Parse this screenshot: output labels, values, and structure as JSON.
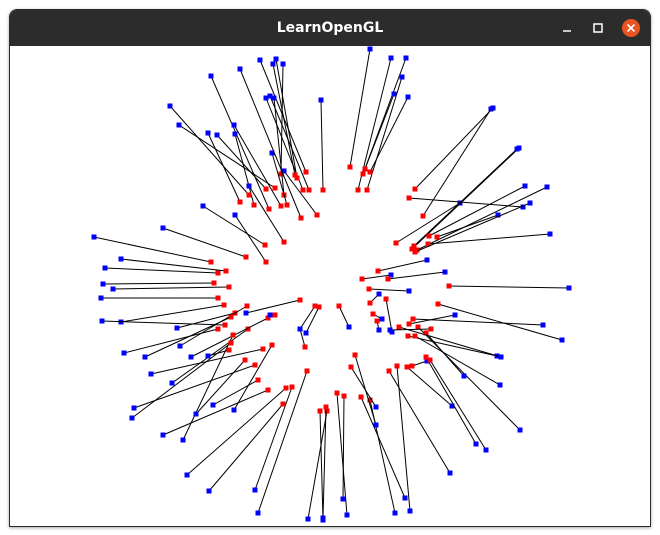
{
  "window": {
    "title": "LearnOpenGL",
    "controls": {
      "minimize_icon": "minimize-icon",
      "maximize_icon": "maximize-icon",
      "close_icon": "close-icon"
    },
    "colors": {
      "titlebar": "#2c2c2c",
      "title_text": "#ffffff",
      "close_button": "#e95420"
    }
  },
  "scene": {
    "background": "#ffffff",
    "line_color": "#000000",
    "start_point_color": "#ff0000",
    "end_point_color": "#0000ff",
    "segments": [
      [
        350,
        167,
        370,
        49
      ],
      [
        358,
        190,
        391,
        58
      ],
      [
        363,
        174,
        406,
        58
      ],
      [
        367,
        190,
        402,
        77
      ],
      [
        370,
        172,
        408,
        97
      ],
      [
        365,
        169,
        394,
        94
      ],
      [
        323,
        190,
        321,
        100
      ],
      [
        309,
        190,
        270,
        96
      ],
      [
        303,
        190,
        266,
        98
      ],
      [
        297,
        178,
        276,
        59
      ],
      [
        295,
        175,
        273,
        64
      ],
      [
        281,
        174,
        283,
        64
      ],
      [
        306,
        172,
        260,
        60
      ],
      [
        284,
        195,
        274,
        98
      ],
      [
        287,
        205,
        272,
        153
      ],
      [
        317,
        215,
        284,
        171
      ],
      [
        301,
        218,
        240,
        69
      ],
      [
        269,
        209,
        211,
        76
      ],
      [
        281,
        206,
        234,
        125
      ],
      [
        254,
        205,
        235,
        134
      ],
      [
        275,
        188,
        179,
        125
      ],
      [
        249,
        195,
        170,
        106
      ],
      [
        266,
        189,
        217,
        135
      ],
      [
        240,
        202,
        208,
        133
      ],
      [
        284,
        242,
        249,
        186
      ],
      [
        265,
        245,
        203,
        206
      ],
      [
        246,
        257,
        163,
        228
      ],
      [
        266,
        262,
        235,
        215
      ],
      [
        211,
        262,
        94,
        237
      ],
      [
        218,
        273,
        105,
        268
      ],
      [
        226,
        271,
        121,
        259
      ],
      [
        229,
        287,
        113,
        289
      ],
      [
        214,
        283,
        103,
        284
      ],
      [
        218,
        298,
        101,
        298
      ],
      [
        224,
        305,
        121,
        322
      ],
      [
        225,
        325,
        102,
        321
      ],
      [
        235,
        313,
        177,
        328
      ],
      [
        247,
        306,
        180,
        346
      ],
      [
        231,
        317,
        145,
        357
      ],
      [
        218,
        329,
        124,
        353
      ],
      [
        248,
        329,
        172,
        383
      ],
      [
        268,
        318,
        191,
        357
      ],
      [
        263,
        349,
        151,
        374
      ],
      [
        255,
        365,
        134,
        408
      ],
      [
        233,
        335,
        183,
        440
      ],
      [
        231,
        343,
        132,
        418
      ],
      [
        258,
        380,
        213,
        405
      ],
      [
        272,
        345,
        234,
        410
      ],
      [
        245,
        360,
        196,
        414
      ],
      [
        268,
        390,
        163,
        435
      ],
      [
        286,
        388,
        187,
        475
      ],
      [
        292,
        387,
        255,
        490
      ],
      [
        283,
        404,
        209,
        491
      ],
      [
        307,
        371,
        258,
        513
      ],
      [
        327,
        411,
        308,
        519
      ],
      [
        320,
        411,
        323,
        520
      ],
      [
        326,
        407,
        323,
        518
      ],
      [
        337,
        393,
        347,
        515
      ],
      [
        344,
        396,
        343,
        499
      ],
      [
        361,
        397,
        405,
        498
      ],
      [
        370,
        400,
        395,
        513
      ],
      [
        355,
        355,
        376,
        425
      ],
      [
        389,
        371,
        450,
        473
      ],
      [
        397,
        366,
        410,
        511
      ],
      [
        351,
        367,
        376,
        407
      ],
      [
        407,
        367,
        452,
        406
      ],
      [
        412,
        366,
        427,
        361
      ],
      [
        408,
        336,
        497,
        356
      ],
      [
        426,
        357,
        476,
        444
      ],
      [
        430,
        360,
        486,
        450
      ],
      [
        409,
        324,
        455,
        315
      ],
      [
        418,
        327,
        520,
        430
      ],
      [
        426,
        333,
        464,
        376
      ],
      [
        413,
        319,
        543,
        325
      ],
      [
        438,
        304,
        562,
        340
      ],
      [
        415,
        336,
        500,
        385
      ],
      [
        399,
        327,
        501,
        357
      ],
      [
        377,
        321,
        379,
        330
      ],
      [
        373,
        314,
        382,
        319
      ],
      [
        370,
        303,
        379,
        294
      ],
      [
        386,
        299,
        392,
        332
      ],
      [
        431,
        329,
        390,
        330
      ],
      [
        449,
        286,
        569,
        288
      ],
      [
        369,
        289,
        409,
        291
      ],
      [
        362,
        279,
        391,
        275
      ],
      [
        378,
        271,
        427,
        260
      ],
      [
        388,
        279,
        445,
        272
      ],
      [
        396,
        243,
        460,
        203
      ],
      [
        412,
        249,
        519,
        148
      ],
      [
        414,
        246,
        517,
        149
      ],
      [
        417,
        250,
        547,
        187
      ],
      [
        423,
        216,
        491,
        109
      ],
      [
        429,
        236,
        525,
        186
      ],
      [
        428,
        244,
        550,
        234
      ],
      [
        437,
        237,
        498,
        215
      ],
      [
        415,
        189,
        493,
        108
      ],
      [
        409,
        198,
        523,
        207
      ],
      [
        415,
        252,
        530,
        203
      ],
      [
        339,
        306,
        349,
        327
      ],
      [
        319,
        307,
        306,
        333
      ],
      [
        315,
        306,
        300,
        329
      ],
      [
        305,
        347,
        300,
        329
      ],
      [
        300,
        300,
        246,
        313
      ],
      [
        275,
        315,
        270,
        315
      ],
      [
        229,
        350,
        208,
        356
      ]
    ]
  }
}
